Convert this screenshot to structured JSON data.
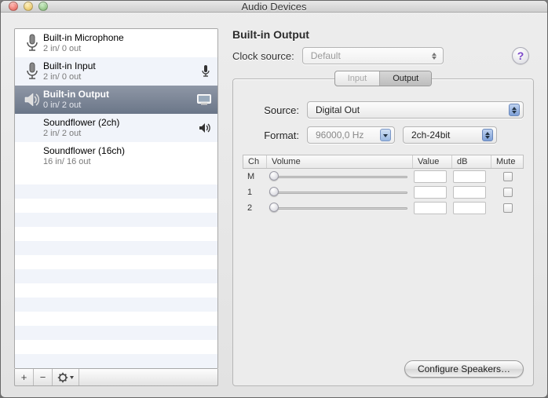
{
  "window": {
    "title": "Audio Devices"
  },
  "devices": [
    {
      "name": "Built-in Microphone",
      "io": "2 in/ 0 out"
    },
    {
      "name": "Built-in Input",
      "io": "2 in/ 0 out"
    },
    {
      "name": "Built-in Output",
      "io": "0 in/ 2 out"
    },
    {
      "name": "Soundflower (2ch)",
      "io": "2 in/ 2 out"
    },
    {
      "name": "Soundflower (16ch)",
      "io": "16 in/ 16 out"
    }
  ],
  "detail": {
    "title": "Built-in Output",
    "clock_label": "Clock source:",
    "clock_value": "Default",
    "tabs": {
      "input": "Input",
      "output": "Output"
    },
    "source_label": "Source:",
    "source_value": "Digital Out",
    "format_label": "Format:",
    "format_rate": "96000,0 Hz",
    "format_bits": "2ch-24bit",
    "columns": {
      "ch": "Ch",
      "vol": "Volume",
      "val": "Value",
      "db": "dB",
      "mute": "Mute"
    },
    "channels": [
      {
        "label": "M"
      },
      {
        "label": "1"
      },
      {
        "label": "2"
      }
    ],
    "configure": "Configure Speakers…"
  },
  "help_glyph": "?",
  "toolbar": {
    "plus": "+",
    "minus": "−",
    "gear": "✻▾"
  }
}
